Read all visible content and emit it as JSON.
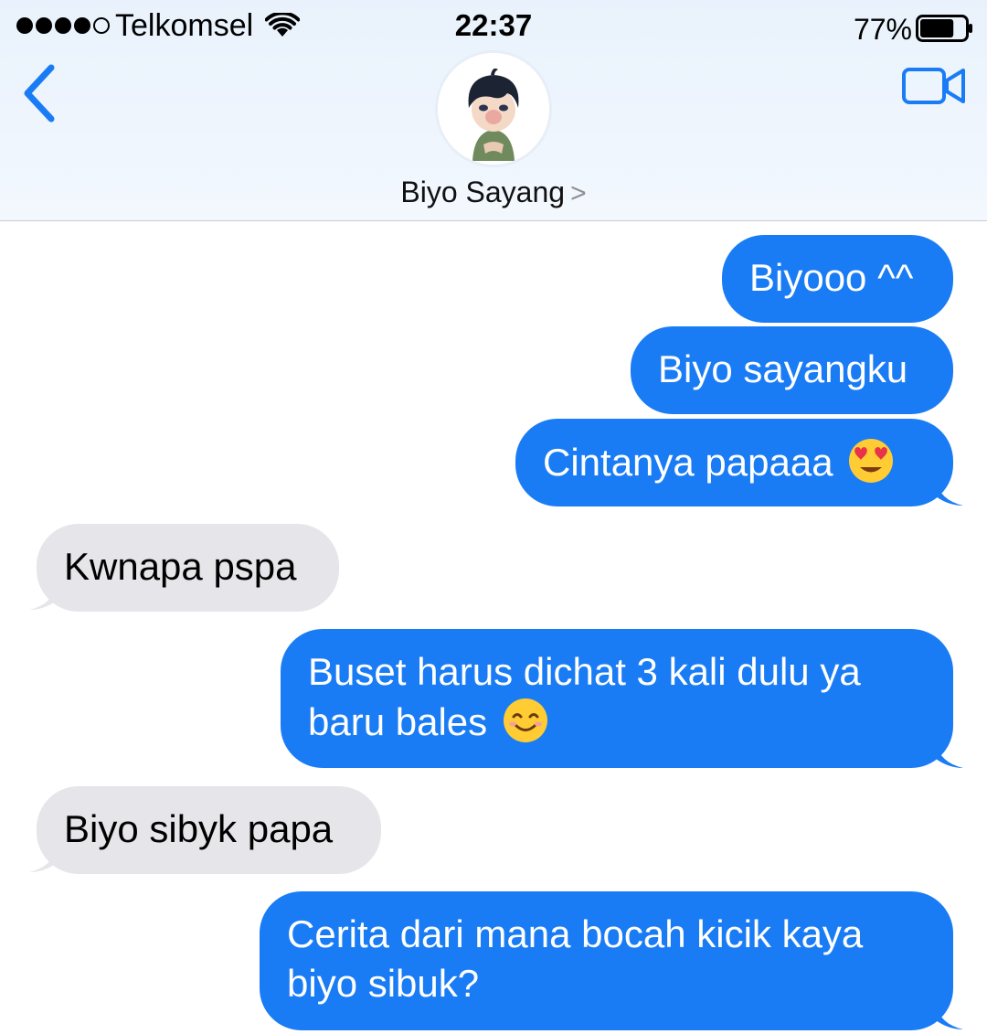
{
  "status_bar": {
    "carrier": "Telkomsel",
    "signal_bars_filled": 4,
    "signal_bars_total": 5,
    "time": "22:37",
    "battery_percent": "77%",
    "battery_level": 0.77
  },
  "nav": {
    "back_icon": "chevron-left-icon",
    "video_icon": "video-camera-icon",
    "contact_name": "Biyo Sayang",
    "contact_chevron": ">",
    "accent_color": "#1a7cf5"
  },
  "messages": [
    {
      "direction": "out",
      "text": "Biyooo ^^"
    },
    {
      "direction": "out",
      "text": "Biyo sayangku"
    },
    {
      "direction": "out",
      "text": "Cintanya papaaa",
      "emoji": "heart-eyes-emoji"
    },
    {
      "direction": "in",
      "text": "Kwnapa pspa"
    },
    {
      "direction": "out",
      "line1": "Buset harus dichat 3 kali dulu ya",
      "line2": "baru bales",
      "emoji": "smiling-face-emoji"
    },
    {
      "direction": "in",
      "text": "Biyo sibyk papa"
    },
    {
      "direction": "out",
      "line1": "Cerita dari mana bocah kicik kaya",
      "line2": "biyo sibuk?"
    }
  ],
  "colors": {
    "outgoing_bubble": "#1a7cf5",
    "incoming_bubble": "#e5e5ea"
  }
}
